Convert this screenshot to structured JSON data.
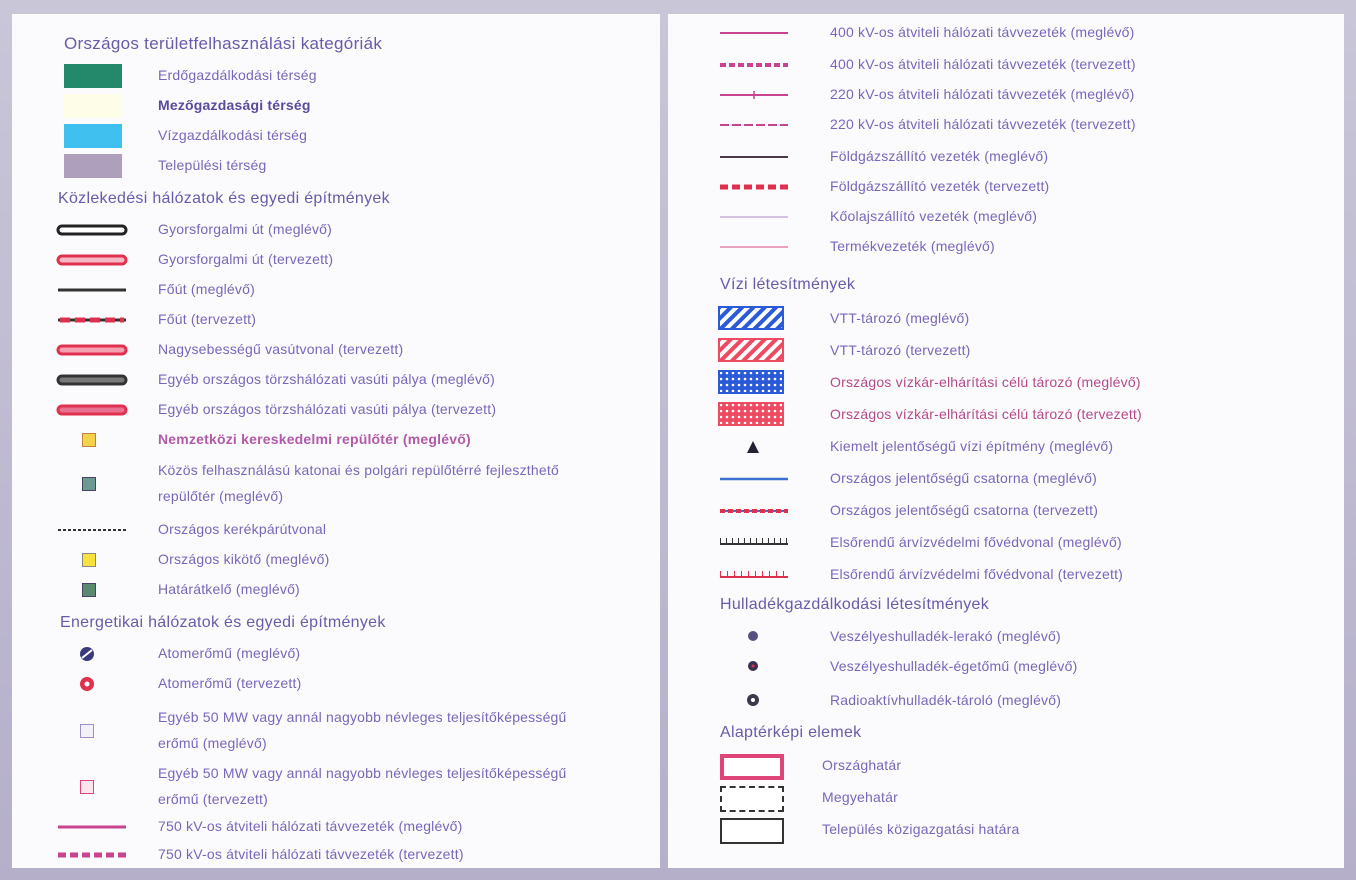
{
  "colors": {
    "forest": "#23896a",
    "agri": "#fdfde8",
    "water": "#3fc0ee",
    "settlement": "#aea0bd",
    "existing_line": "#333333",
    "planned_line": "#e03050",
    "power_line": "#c9448f",
    "canal_line": "#3c6fd0",
    "border_pink": "#e0457a"
  },
  "left": {
    "land_use": {
      "heading": "Országos területfelhasználási kategóriák",
      "items": [
        {
          "label": "Erdőgazdálkodási térség",
          "icon": "forest-swatch"
        },
        {
          "label": "Mezőgazdasági térség",
          "icon": "agri-swatch"
        },
        {
          "label": "Vízgazdálkodási térség",
          "icon": "water-swatch"
        },
        {
          "label": "Települési térség",
          "icon": "settlement-swatch"
        }
      ]
    },
    "transport": {
      "heading": "Közlekedési hálózatok és egyedi építmények",
      "items": [
        {
          "label": "Gyorsforgalmi út (meglévő)"
        },
        {
          "label": "Gyorsforgalmi út (tervezett)"
        },
        {
          "label": "Főút (meglévő)"
        },
        {
          "label": "Főút (tervezett)"
        },
        {
          "label": "Nagysebességű vasútvonal (tervezett)"
        },
        {
          "label": "Egyéb országos törzshálózati vasúti pálya (meglévő)"
        },
        {
          "label": "Egyéb országos törzshálózati vasúti pálya (tervezett)"
        },
        {
          "label": "Nemzetközi kereskedelmi repülőtér (meglévő)"
        },
        {
          "label": "Közös felhasználású katonai és polgári repülőtérré fejleszthető repülőtér (meglévő)"
        },
        {
          "label": "Országos kerékpárútvonal"
        },
        {
          "label": "Országos kikötő (meglévő)"
        },
        {
          "label": "Határátkelő (meglévő)"
        }
      ]
    },
    "energy": {
      "heading": "Energetikai hálózatok és egyedi építmények",
      "items": [
        {
          "label": "Atomerőmű (meglévő)"
        },
        {
          "label": "Atomerőmű (tervezett)"
        },
        {
          "label": "Egyéb 50 MW vagy annál nagyobb névleges teljesítőképességű erőmű (meglévő)"
        },
        {
          "label": "Egyéb 50 MW vagy annál nagyobb névleges teljesítőképességű erőmű (tervezett)"
        },
        {
          "label": "750 kV-os átviteli hálózati távvezeték (meglévő)"
        },
        {
          "label": "750 kV-os átviteli hálózati távvezeték (tervezett)"
        }
      ]
    }
  },
  "right": {
    "energy_cont": {
      "items": [
        {
          "label": "400 kV-os átviteli hálózati távvezeték (meglévő)"
        },
        {
          "label": "400 kV-os átviteli hálózati távvezeték (tervezett)"
        },
        {
          "label": "220 kV-os átviteli hálózati távvezeték (meglévő)"
        },
        {
          "label": "220 kV-os átviteli hálózati távvezeték (tervezett)"
        },
        {
          "label": "Földgázszállító vezeték (meglévő)"
        },
        {
          "label": "Földgázszállító vezeték (tervezett)"
        },
        {
          "label": "Kőolajszállító vezeték (meglévő)"
        },
        {
          "label": "Termékvezeték (meglévő)"
        }
      ]
    },
    "water": {
      "heading": "Vízi létesítmények",
      "items": [
        {
          "label": "VTT-tározó (meglévő)"
        },
        {
          "label": "VTT-tározó (tervezett)"
        },
        {
          "label": "Országos vízkár-elhárítási célú tározó (meglévő)"
        },
        {
          "label": "Országos vízkár-elhárítási célú tározó (tervezett)"
        },
        {
          "label": "Kiemelt jelentőségű vízi építmény (meglévő)"
        },
        {
          "label": "Országos jelentőségű csatorna (meglévő)"
        },
        {
          "label": "Országos jelentőségű csatorna (tervezett)"
        },
        {
          "label": "Elsőrendű árvízvédelmi fővédvonal (meglévő)"
        },
        {
          "label": "Elsőrendű árvízvédelmi fővédvonal (tervezett)"
        }
      ]
    },
    "waste": {
      "heading": "Hulladékgazdálkodási létesítmények",
      "items": [
        {
          "label": "Veszélyeshulladék-lerakó (meglévő)"
        },
        {
          "label": "Veszélyeshulladék-égetőmű (meglévő)"
        },
        {
          "label": "Radioaktívhulladék-tároló (meglévő)"
        }
      ]
    },
    "base": {
      "heading": "Alaptérképi elemek",
      "items": [
        {
          "label": "Országhatár"
        },
        {
          "label": "Megyehatár"
        },
        {
          "label": "Település közigazgatási határa"
        }
      ]
    }
  }
}
